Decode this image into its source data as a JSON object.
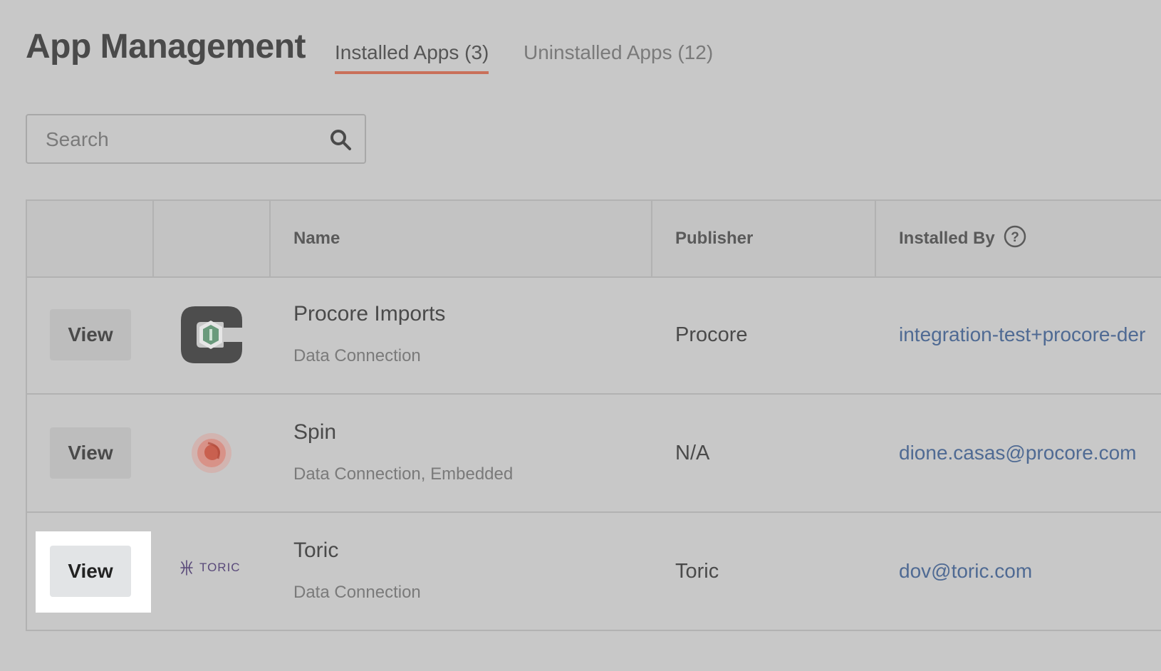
{
  "header": {
    "title": "App Management",
    "tabs": [
      {
        "label": "Installed Apps (3)",
        "active": true
      },
      {
        "label": "Uninstalled Apps (12)",
        "active": false
      }
    ]
  },
  "search": {
    "placeholder": "Search",
    "value": ""
  },
  "table": {
    "columns": [
      "",
      "",
      "Name",
      "Publisher",
      "Installed By"
    ],
    "rows": [
      {
        "action": "View",
        "name": "Procore Imports",
        "type": "Data Connection",
        "publisher": "Procore",
        "installed_by": "integration-test+procore-der",
        "logo": "procore-imports-logo"
      },
      {
        "action": "View",
        "name": "Spin",
        "type": "Data Connection, Embedded",
        "publisher": "N/A",
        "installed_by": "dione.casas@procore.com",
        "logo": "spin-logo"
      },
      {
        "action": "View",
        "name": "Toric",
        "type": "Data Connection",
        "publisher": "Toric",
        "installed_by": "dov@toric.com",
        "logo": "toric-logo",
        "logo_text": "TORIC"
      }
    ]
  },
  "colors": {
    "accent": "#c9705a",
    "link": "#4f6a93",
    "background": "#c8c8c8"
  }
}
